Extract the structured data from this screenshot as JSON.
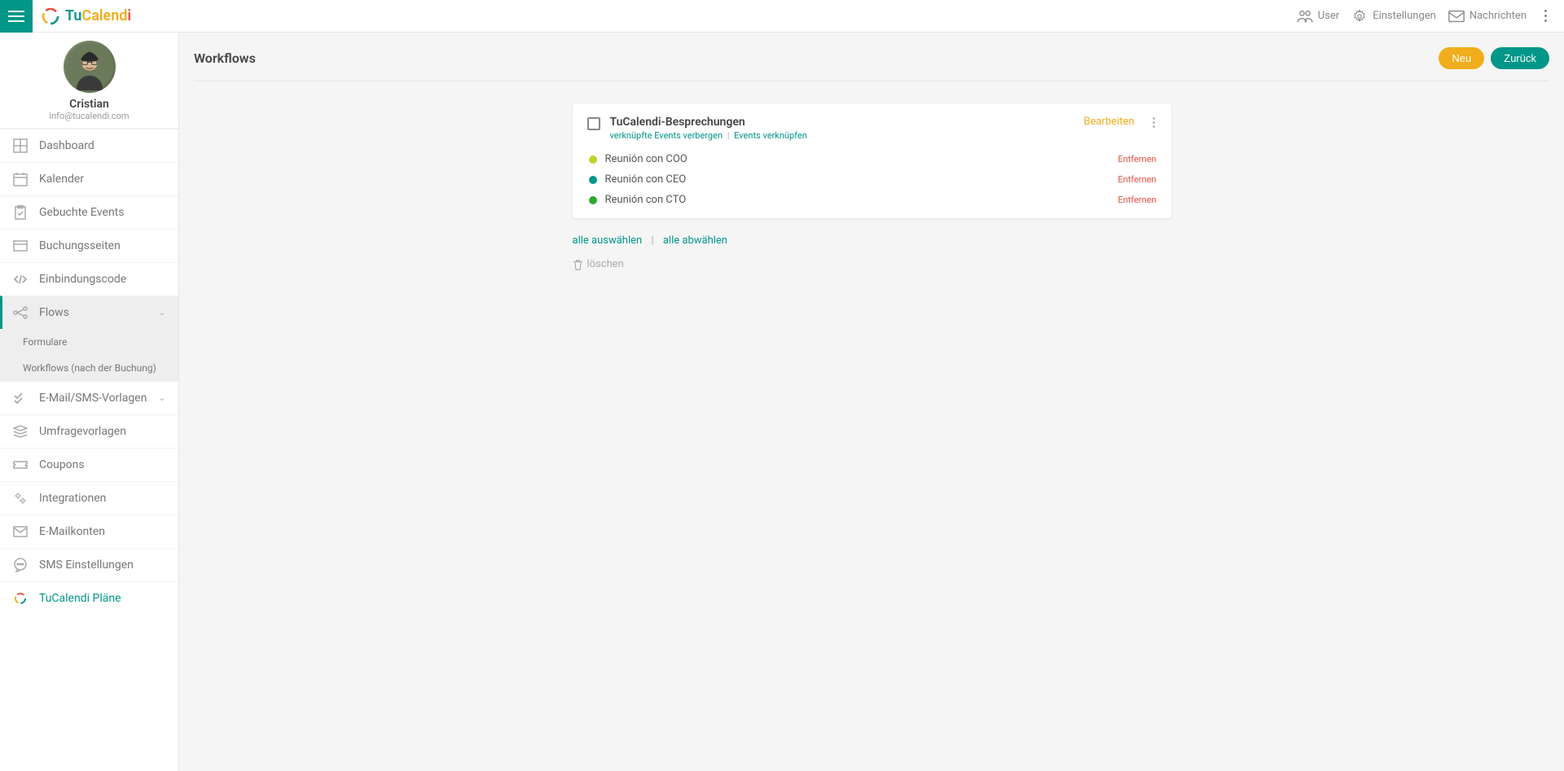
{
  "brand": {
    "tu": "Tu",
    "calend": "Calend",
    "i": "i"
  },
  "topbar": {
    "user": "User",
    "settings": "Einstellungen",
    "messages": "Nachrichten"
  },
  "profile": {
    "name": "Cristian",
    "email": "info@tucalendi.com"
  },
  "nav": {
    "dashboard": "Dashboard",
    "calendar": "Kalender",
    "booked": "Gebuchte Events",
    "pages": "Buchungsseiten",
    "embed": "Einbindungscode",
    "flows": "Flows",
    "flows_sub_forms": "Formulare",
    "flows_sub_workflows": "Workflows (nach der Buchung)",
    "templates": "E-Mail/SMS-Vorlagen",
    "surveys": "Umfragevorlagen",
    "coupons": "Coupons",
    "integrations": "Integrationen",
    "mailaccounts": "E-Mailkonten",
    "sms": "SMS Einstellungen",
    "plans": "TuCalendi Pläne"
  },
  "page": {
    "title": "Workflows",
    "new": "Neu",
    "back": "Zurück"
  },
  "workflow": {
    "title": "TuCalendi-Besprechungen",
    "hide_linked": "verknüpfte Events verbergen",
    "link_events": "Events verknüpfen",
    "edit": "Bearbeiten",
    "events": [
      {
        "name": "Reunión con COO",
        "color": "#c0d22e",
        "remove": "Entfernen"
      },
      {
        "name": "Reunión con CEO",
        "color": "#009688",
        "remove": "Entfernen"
      },
      {
        "name": "Reunión con CTO",
        "color": "#2fa82f",
        "remove": "Entfernen"
      }
    ]
  },
  "batch": {
    "select_all": "alle auswählen",
    "deselect_all": "alle abwählen",
    "delete": "löschen"
  }
}
